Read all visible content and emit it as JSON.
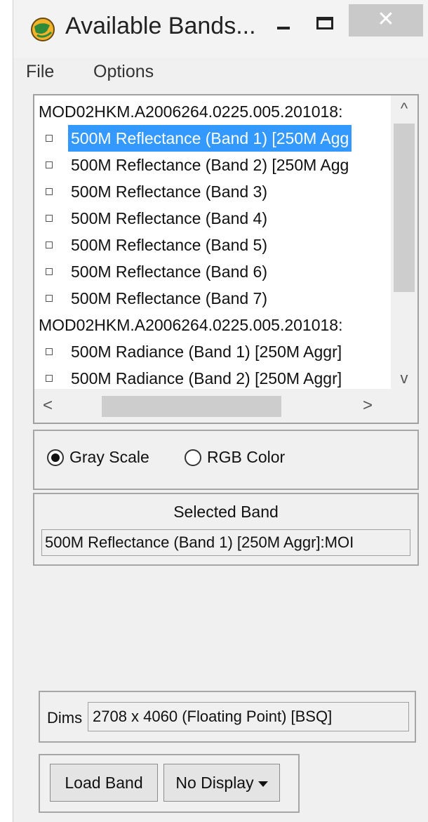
{
  "window": {
    "title": "Available Bands...",
    "close_glyph": "✕",
    "icon": "globe-icon"
  },
  "menu": {
    "file": "File",
    "options": "Options"
  },
  "band_list": {
    "groups": [
      {
        "label": "MOD02HKM.A2006264.0225.005.201018:",
        "items": [
          "500M Reflectance (Band 1) [250M Agg",
          "500M Reflectance (Band 2) [250M Agg",
          "500M Reflectance (Band 3)",
          "500M Reflectance (Band 4)",
          "500M Reflectance (Band 5)",
          "500M Reflectance (Band 6)",
          "500M Reflectance (Band 7)"
        ]
      },
      {
        "label": "MOD02HKM.A2006264.0225.005.201018:",
        "items": [
          "500M Radiance (Band 1) [250M Aggr]",
          "500M Radiance (Band 2) [250M Aggr]"
        ]
      }
    ],
    "selected_item": "500M Reflectance (Band 1) [250M Agg",
    "scroll_up_glyph": "^",
    "scroll_down_glyph": "v",
    "scroll_left_glyph": "<",
    "scroll_right_glyph": ">"
  },
  "color_mode": {
    "gray_label": "Gray Scale",
    "rgb_label": "RGB Color",
    "selected": "Gray Scale"
  },
  "selected_band": {
    "heading": "Selected Band",
    "value": "500M Reflectance (Band 1) [250M Aggr]:MOI"
  },
  "dims": {
    "label": "Dims",
    "value": "2708 x 4060 (Floating Point) [BSQ]"
  },
  "actions": {
    "load_band": "Load Band",
    "display_select": "No Display"
  }
}
